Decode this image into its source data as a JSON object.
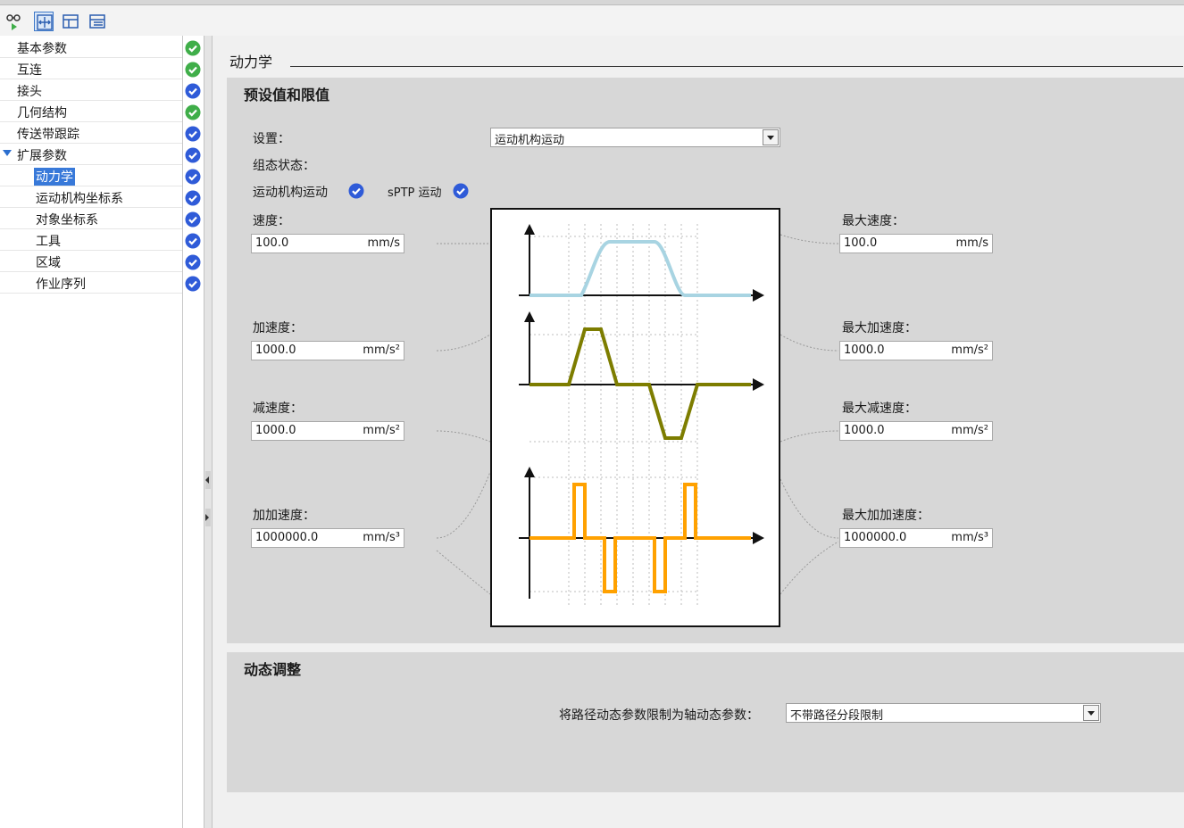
{
  "toolbar": {
    "buttons": [
      {
        "icon": "glasses-play-icon"
      },
      {
        "icon": "expand-all-icon"
      },
      {
        "icon": "tree-icon"
      },
      {
        "icon": "tree-collapse-icon"
      }
    ]
  },
  "sidebar": {
    "items": [
      {
        "label": "基本参数",
        "status": "ok"
      },
      {
        "label": "互连",
        "status": "ok"
      },
      {
        "label": "接头",
        "status": "done"
      },
      {
        "label": "几何结构",
        "status": "ok"
      },
      {
        "label": "传送带跟踪",
        "status": "done"
      },
      {
        "label": "扩展参数",
        "status": "done"
      },
      {
        "label": "动力学",
        "status": "done"
      },
      {
        "label": "运动机构坐标系",
        "status": "done"
      },
      {
        "label": "对象坐标系",
        "status": "done"
      },
      {
        "label": "工具",
        "status": "done"
      },
      {
        "label": "区域",
        "status": "done"
      },
      {
        "label": "作业序列",
        "status": "done"
      }
    ]
  },
  "colors": {
    "ok": "#3fae49",
    "done": "#2f5bd8",
    "velocity": "#a8d4e2",
    "accel": "#7d7d00",
    "jerk": "#ffa100",
    "selection": "#3879d9"
  },
  "main": {
    "title": "动力学",
    "presets": {
      "title": "预设值和限值",
      "setting_label": "设置：",
      "setting_value": "运动机构运动",
      "config_label": "组态状态：",
      "state1": "运动机构运动",
      "state2": "sPTP 运动",
      "velocity_label": "速度：",
      "velocity_value": "100.0",
      "velocity_unit": "mm/s",
      "accel_label": "加速度：",
      "accel_value": "1000.0",
      "accel_unit": "mm/s²",
      "decel_label": "减速度：",
      "decel_value": "1000.0",
      "decel_unit": "mm/s²",
      "jerk_label": "加加速度：",
      "jerk_value": "1000000.0",
      "jerk_unit": "mm/s³",
      "max_velocity_label": "最大速度：",
      "max_velocity_value": "100.0",
      "max_velocity_unit": "mm/s",
      "max_accel_label": "最大加速度：",
      "max_accel_value": "1000.0",
      "max_accel_unit": "mm/s²",
      "max_decel_label": "最大减速度：",
      "max_decel_value": "1000.0",
      "max_decel_unit": "mm/s²",
      "max_jerk_label": "最大加加速度：",
      "max_jerk_value": "1000000.0",
      "max_jerk_unit": "mm/s³"
    },
    "dynamic": {
      "title": "动态调整",
      "limit_label": "将路径动态参数限制为轴动态参数：",
      "limit_value": "不带路径分段限制"
    }
  }
}
